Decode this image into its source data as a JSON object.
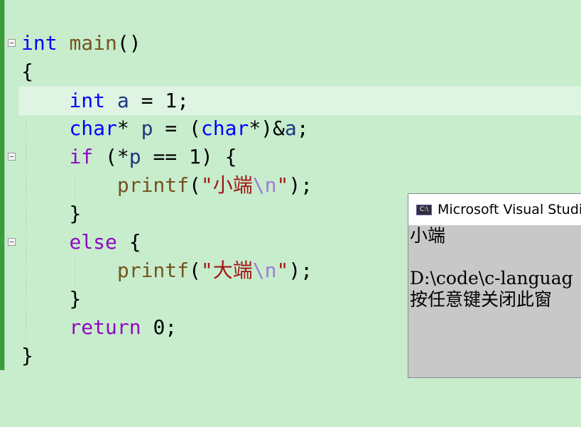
{
  "editor": {
    "lines": {
      "l1": {
        "type": "int",
        "space": " ",
        "name": "main",
        "parens": "()"
      },
      "l2": {
        "brace": "{"
      },
      "l3": {
        "indent": "    ",
        "type": "int",
        "sp": " ",
        "var": "a",
        "rest": " = 1;"
      },
      "l4": {
        "indent": "    ",
        "type": "char",
        "star": "* ",
        "var": "p",
        "mid": " = (",
        "cast": "char",
        "castend": "*)&",
        "var2": "a",
        "end": ";"
      },
      "l5": {
        "indent": "    ",
        "kw": "if",
        "mid": " (*",
        "var": "p",
        "rest": " == 1) {"
      },
      "l6": {
        "indent": "        ",
        "fn": "printf",
        "open": "(",
        "q1": "\"",
        "text": "小端",
        "esc": "\\n",
        "q2": "\"",
        "close": ");"
      },
      "l7": {
        "indent": "    ",
        "brace": "}"
      },
      "l8": {
        "indent": "    ",
        "kw": "else",
        "rest": " {"
      },
      "l9": {
        "indent": "        ",
        "fn": "printf",
        "open": "(",
        "q1": "\"",
        "text": "大端",
        "esc": "\\n",
        "q2": "\"",
        "close": ");"
      },
      "l10": {
        "indent": "    ",
        "brace": "}"
      },
      "l11": {
        "indent": "    ",
        "kw": "return",
        "rest": " 0;"
      },
      "l12": {
        "brace": "}"
      }
    }
  },
  "console": {
    "icon_label": "C:\\",
    "title": "Microsoft Visual Studio",
    "output": "小端\n\nD:\\code\\c-languag\n按任意键关闭此窗"
  },
  "colors": {
    "background": "#c7edcc",
    "keyword": "#0000ff",
    "function": "#74531f",
    "string": "#a31515",
    "control": "#8f08c4"
  }
}
